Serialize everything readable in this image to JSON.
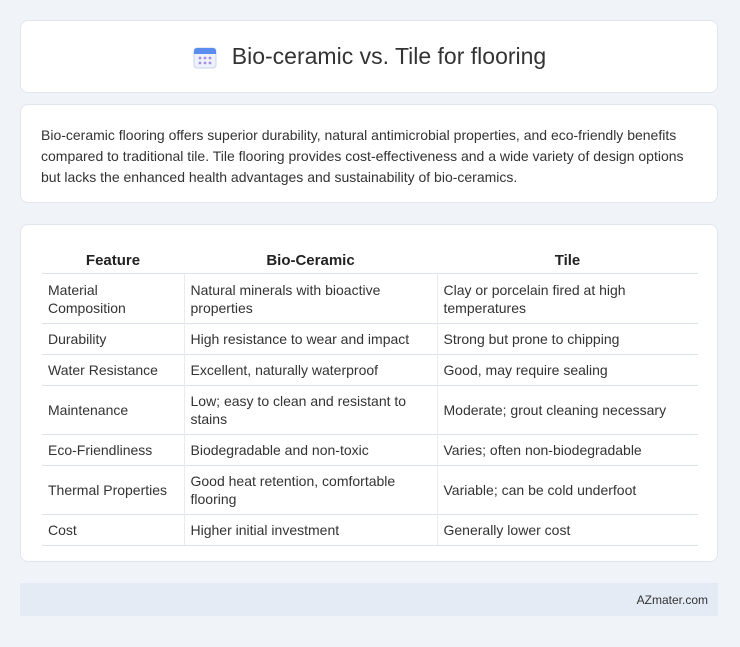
{
  "header": {
    "title": "Bio-ceramic vs. Tile for flooring",
    "icon": "calendar-icon"
  },
  "summary": "Bio-ceramic flooring offers superior durability, natural antimicrobial properties, and eco-friendly benefits compared to traditional tile. Tile flooring provides cost-effectiveness and a wide variety of design options but lacks the enhanced health advantages and sustainability of bio-ceramics.",
  "table": {
    "headers": [
      "Feature",
      "Bio-Ceramic",
      "Tile"
    ],
    "rows": [
      [
        "Material Composition",
        "Natural minerals with bioactive properties",
        "Clay or porcelain fired at high temperatures"
      ],
      [
        "Durability",
        "High resistance to wear and impact",
        "Strong but prone to chipping"
      ],
      [
        "Water Resistance",
        "Excellent, naturally waterproof",
        "Good, may require sealing"
      ],
      [
        "Maintenance",
        "Low; easy to clean and resistant to stains",
        "Moderate; grout cleaning necessary"
      ],
      [
        "Eco-Friendliness",
        "Biodegradable and non-toxic",
        "Varies; often non-biodegradable"
      ],
      [
        "Thermal Properties",
        "Good heat retention, comfortable flooring",
        "Variable; can be cold underfoot"
      ],
      [
        "Cost",
        "Higher initial investment",
        "Generally lower cost"
      ]
    ]
  },
  "footer": {
    "brand": "AZmater.com"
  },
  "colors": {
    "background": "#f0f3f8",
    "footer_bg": "#e4ebf5",
    "icon_blue": "#5b8def"
  }
}
